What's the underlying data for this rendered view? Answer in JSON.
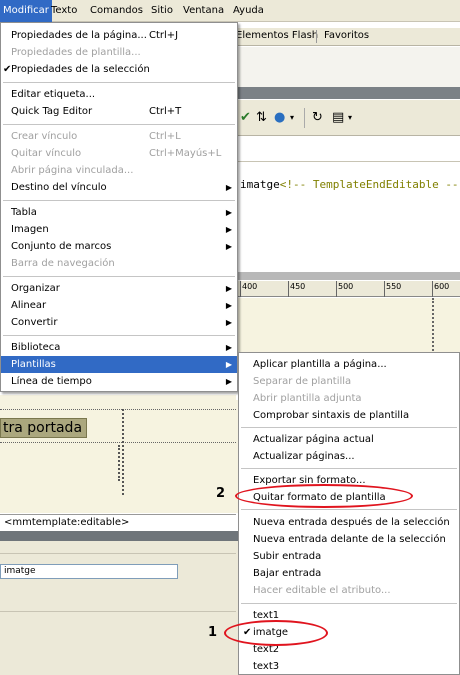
{
  "menubar": {
    "items": [
      "Modificar",
      "Texto",
      "Comandos",
      "Sitio",
      "Ventana",
      "Ayuda"
    ],
    "active": "Modificar"
  },
  "background": {
    "panel_tabs": [
      "Elementos Flash",
      "Favoritos"
    ],
    "code_line": {
      "text": "imatge",
      "comment": "<!-- TemplateEndEditable --"
    },
    "ruler_labels": [
      "400",
      "450",
      "500",
      "550",
      "600"
    ],
    "design_text": "tra portada",
    "tag_selector": "<mmtemplate:editable>",
    "property_field": "imatge"
  },
  "main_menu": {
    "items": [
      {
        "label": "Propiedades de la página...",
        "shortcut": "Ctrl+J",
        "disabled": false
      },
      {
        "label": "Propiedades de plantilla...",
        "shortcut": "",
        "disabled": true
      },
      {
        "label": "Propiedades de la selección",
        "shortcut": "",
        "disabled": false,
        "checked": true
      },
      {
        "label": "Editar etiqueta...",
        "shortcut": "",
        "disabled": false
      },
      {
        "label": "Quick Tag Editor",
        "shortcut": "Ctrl+T",
        "disabled": false
      },
      {
        "label": "Crear vínculo",
        "shortcut": "Ctrl+L",
        "disabled": true
      },
      {
        "label": "Quitar vínculo",
        "shortcut": "Ctrl+Mayús+L",
        "disabled": true
      },
      {
        "label": "Abrir página vinculada...",
        "shortcut": "",
        "disabled": true
      },
      {
        "label": "Destino del vínculo",
        "shortcut": "",
        "disabled": false,
        "submenu": true
      },
      {
        "label": "Tabla",
        "shortcut": "",
        "disabled": false,
        "submenu": true
      },
      {
        "label": "Imagen",
        "shortcut": "",
        "disabled": false,
        "submenu": true
      },
      {
        "label": "Conjunto de marcos",
        "shortcut": "",
        "disabled": false,
        "submenu": true
      },
      {
        "label": "Barra de navegación",
        "shortcut": "",
        "disabled": true
      },
      {
        "label": "Organizar",
        "shortcut": "",
        "disabled": false,
        "submenu": true
      },
      {
        "label": "Alinear",
        "shortcut": "",
        "disabled": false,
        "submenu": true
      },
      {
        "label": "Convertir",
        "shortcut": "",
        "disabled": false,
        "submenu": true
      },
      {
        "label": "Biblioteca",
        "shortcut": "",
        "disabled": false,
        "submenu": true
      },
      {
        "label": "Plantillas",
        "shortcut": "",
        "disabled": false,
        "submenu": true,
        "highlighted": true
      },
      {
        "label": "Línea de tiempo",
        "shortcut": "",
        "disabled": false,
        "submenu": true
      }
    ]
  },
  "templates_submenu": {
    "items": [
      {
        "label": "Aplicar plantilla a página...",
        "disabled": false
      },
      {
        "label": "Separar de plantilla",
        "disabled": true
      },
      {
        "label": "Abrir plantilla adjunta",
        "disabled": true
      },
      {
        "label": "Comprobar sintaxis de plantilla",
        "disabled": false
      },
      {
        "label": "Actualizar página actual",
        "disabled": false
      },
      {
        "label": "Actualizar páginas...",
        "disabled": false
      },
      {
        "label": "Exportar sin formato...",
        "disabled": false
      },
      {
        "label": "Quitar formato de plantilla",
        "disabled": false
      },
      {
        "label": "Nueva entrada después de la selección",
        "disabled": false
      },
      {
        "label": "Nueva entrada delante de la selección",
        "disabled": false
      },
      {
        "label": "Subir entrada",
        "disabled": false
      },
      {
        "label": "Bajar entrada",
        "disabled": false
      },
      {
        "label": "Hacer editable el atributo...",
        "disabled": true
      },
      {
        "label": "text1",
        "disabled": false
      },
      {
        "label": "imatge",
        "disabled": false,
        "checked": true
      },
      {
        "label": "text2",
        "disabled": false
      },
      {
        "label": "text3",
        "disabled": false
      }
    ]
  },
  "annotations": {
    "step1": "1",
    "step2": "2",
    "ellipse_color": "#e0141e"
  },
  "colors": {
    "menu_highlight": "#316ac5",
    "disabled_text": "#a0a0a0",
    "chrome": "#ece9d8"
  }
}
